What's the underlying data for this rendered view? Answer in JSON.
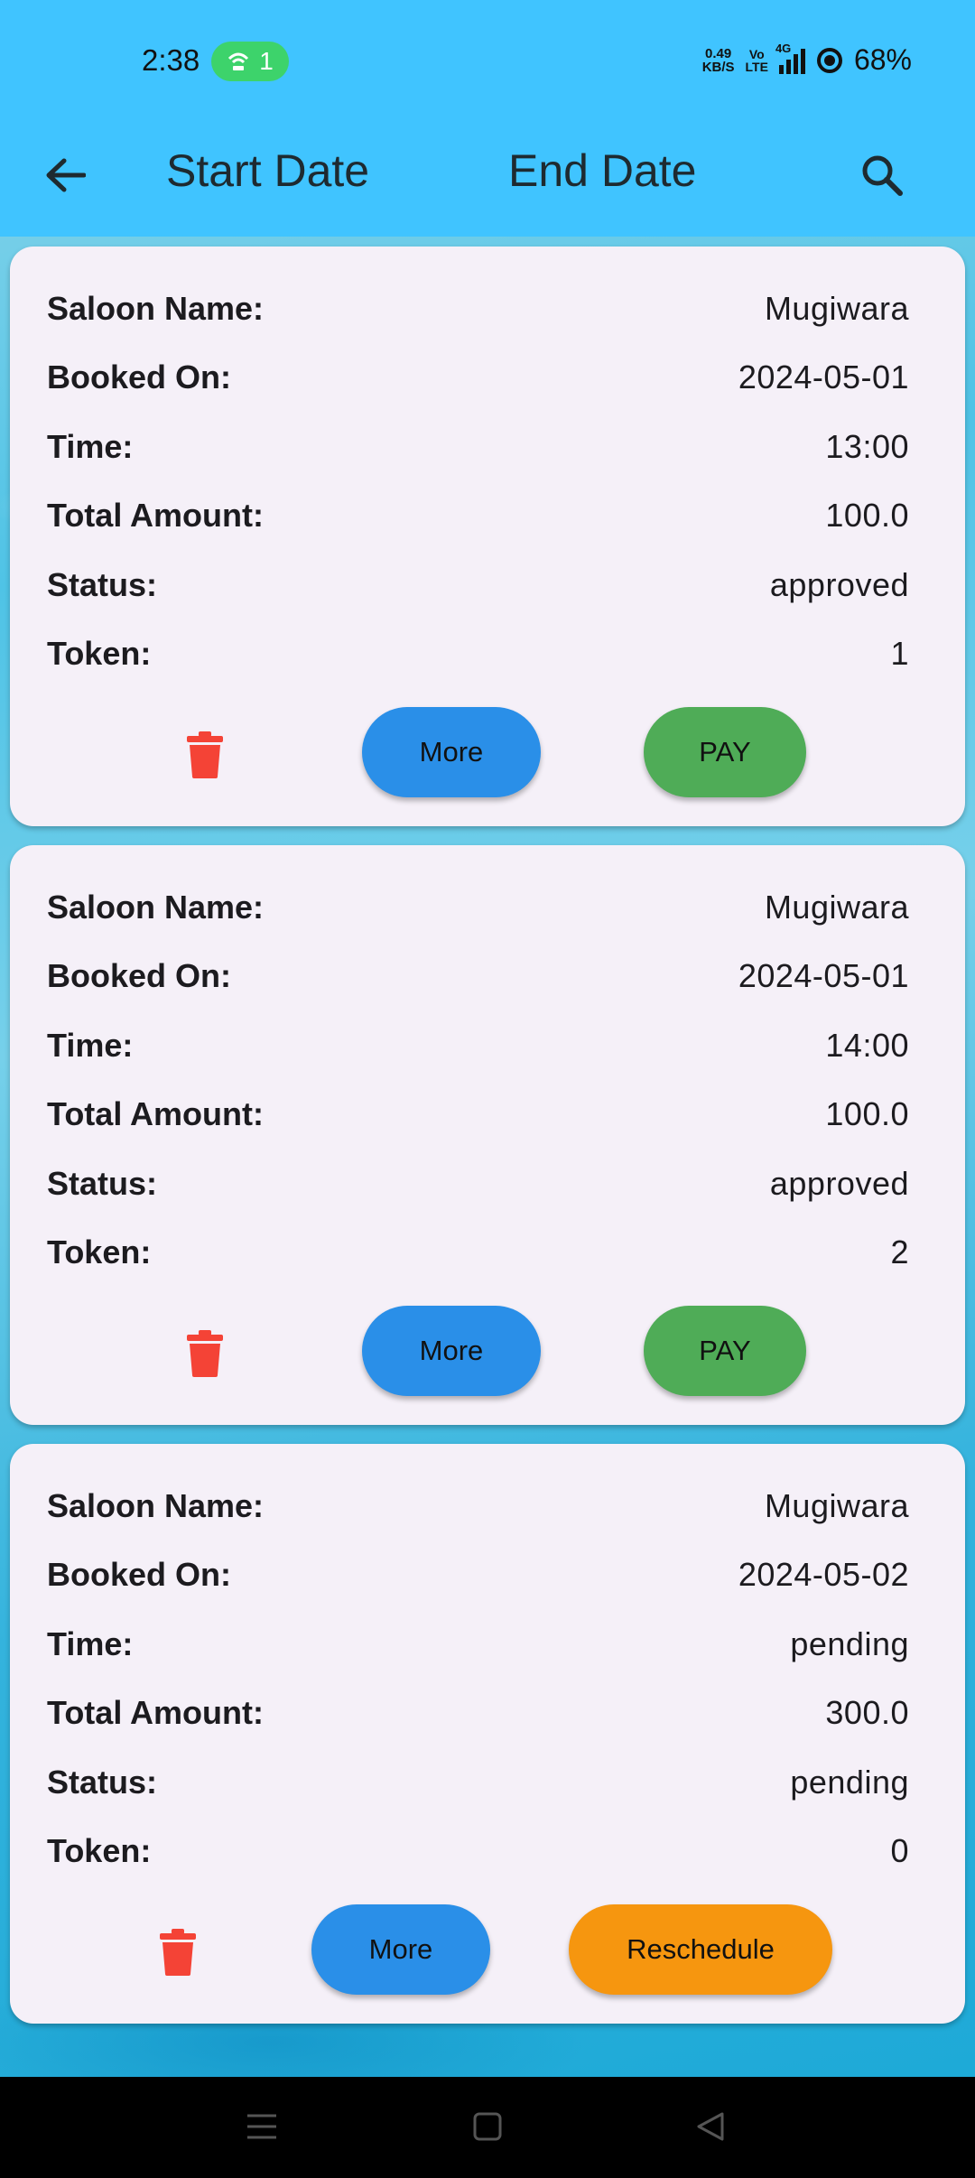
{
  "status_bar": {
    "time": "2:38",
    "hotspot_count": "1",
    "net_speed_value": "0.49",
    "net_speed_unit": "KB/S",
    "volte_top": "Vo",
    "volte_bottom": "LTE",
    "network": "4G",
    "battery": "68%"
  },
  "app_bar": {
    "start_date_label": "Start Date",
    "end_date_label": "End Date"
  },
  "labels": {
    "saloon_name": "Saloon Name:",
    "booked_on": "Booked On:",
    "time": "Time:",
    "total_amount": "Total Amount:",
    "status": "Status:",
    "token": "Token:"
  },
  "bookings": [
    {
      "saloon_name": "Mugiwara",
      "booked_on": "2024-05-01",
      "time": "13:00",
      "total_amount": "100.0",
      "status": "approved",
      "token": "1",
      "more_label": "More",
      "action_label": "PAY"
    },
    {
      "saloon_name": "Mugiwara",
      "booked_on": "2024-05-01",
      "time": "14:00",
      "total_amount": "100.0",
      "status": "approved",
      "token": "2",
      "more_label": "More",
      "action_label": "PAY"
    },
    {
      "saloon_name": "Mugiwara",
      "booked_on": "2024-05-02",
      "time": "pending",
      "total_amount": "300.0",
      "status": "pending",
      "token": "0",
      "more_label": "More",
      "action_label": "Reschedule"
    }
  ],
  "colors": {
    "app_bar": "#40c4ff",
    "card": "#f5f0f8",
    "more_button": "#2a8fe8",
    "pay_button": "#4fac57",
    "reschedule_button": "#f6960f",
    "delete_icon": "#f44336"
  },
  "icons": {
    "back": "arrow-left-icon",
    "search": "search-icon",
    "delete": "trash-icon",
    "nav_menu": "menu-icon",
    "nav_home": "home-icon",
    "nav_back": "back-triangle-icon"
  }
}
